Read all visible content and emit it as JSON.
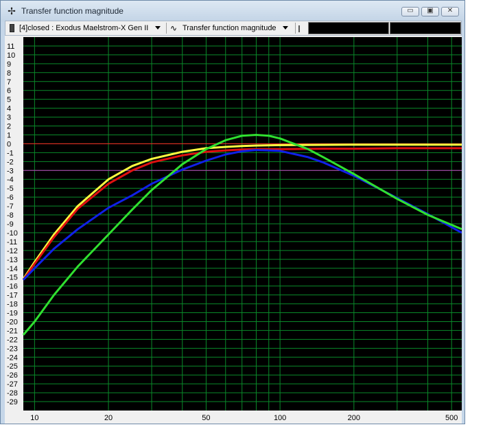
{
  "window": {
    "title": "Transfer function magnitude",
    "title_icon": "crosshair-icon",
    "buttons": [
      "minimize-icon",
      "restore-icon",
      "close-icon"
    ]
  },
  "toolbar": {
    "device_label": "[4]closed : Exodus Maelstrom-X Gen II",
    "view_label": "Transfer function magnitude",
    "view_icon": "waveform-icon"
  },
  "colors": {
    "plot_background": "#000000",
    "grid": "#0a8a2a",
    "yellow": "#ffff40",
    "red": "#e01010",
    "blue": "#1020e8",
    "green": "#30e030",
    "zero_line": "#ff2020",
    "marker_line": "#c040c0"
  },
  "chart_data": {
    "type": "line",
    "x_scale": "log",
    "xlim": [
      9,
      550
    ],
    "ylim": [
      -30,
      12
    ],
    "y_ticks": [
      11,
      10,
      9,
      8,
      7,
      6,
      5,
      4,
      3,
      2,
      1,
      0,
      -1,
      -2,
      -3,
      -4,
      -5,
      -6,
      -7,
      -8,
      -9,
      -10,
      -11,
      -12,
      -13,
      -14,
      -15,
      -16,
      -17,
      -18,
      -19,
      -20,
      -21,
      -22,
      -23,
      -24,
      -25,
      -26,
      -27,
      -28,
      -29
    ],
    "x_tick_labels": [
      10,
      20,
      50,
      100,
      200,
      500
    ],
    "x_grid": [
      10,
      20,
      30,
      40,
      50,
      60,
      70,
      80,
      90,
      100,
      200,
      300,
      400,
      500
    ],
    "grid": true,
    "reference_lines": [
      {
        "y": 0,
        "color": "red"
      },
      {
        "y": -3,
        "color": "marker"
      }
    ],
    "series": [
      {
        "color": "yellow",
        "x": [
          9,
          10,
          12,
          15,
          20,
          25,
          30,
          40,
          50,
          60,
          70,
          80,
          100,
          150,
          200,
          300,
          550
        ],
        "y": [
          -15.2,
          -13.3,
          -10.2,
          -7,
          -4,
          -2.5,
          -1.7,
          -0.9,
          -0.5,
          -0.35,
          -0.25,
          -0.2,
          -0.15,
          -0.12,
          -0.1,
          -0.1,
          -0.1
        ]
      },
      {
        "color": "red",
        "x": [
          9,
          10,
          12,
          15,
          20,
          25,
          30,
          40,
          50,
          60,
          70,
          80,
          100,
          150,
          200,
          300,
          550
        ],
        "y": [
          -15.3,
          -13.5,
          -10.5,
          -7.3,
          -4.5,
          -3,
          -2.1,
          -1.3,
          -0.9,
          -0.75,
          -0.65,
          -0.6,
          -0.6,
          -0.55,
          -0.55,
          -0.5,
          -0.5
        ]
      },
      {
        "color": "blue",
        "x": [
          9,
          10,
          12,
          15,
          20,
          25,
          30,
          40,
          50,
          60,
          70,
          80,
          100,
          130,
          150,
          200,
          300,
          400,
          550
        ],
        "y": [
          -15.3,
          -14,
          -11.8,
          -9.6,
          -7.2,
          -5.8,
          -4.5,
          -2.9,
          -1.9,
          -1.2,
          -0.85,
          -0.7,
          -0.8,
          -1.5,
          -2.1,
          -3.6,
          -6.1,
          -7.9,
          -10
        ]
      },
      {
        "color": "green",
        "x": [
          9,
          10,
          12,
          15,
          20,
          25,
          30,
          40,
          50,
          60,
          70,
          80,
          90,
          100,
          130,
          150,
          200,
          300,
          400,
          550
        ],
        "y": [
          -21.5,
          -20,
          -17,
          -13.8,
          -10.2,
          -7.4,
          -5.2,
          -2.3,
          -0.6,
          0.4,
          0.9,
          1,
          0.9,
          0.6,
          -0.6,
          -1.5,
          -3.4,
          -6.2,
          -8,
          -9.6
        ]
      }
    ]
  }
}
